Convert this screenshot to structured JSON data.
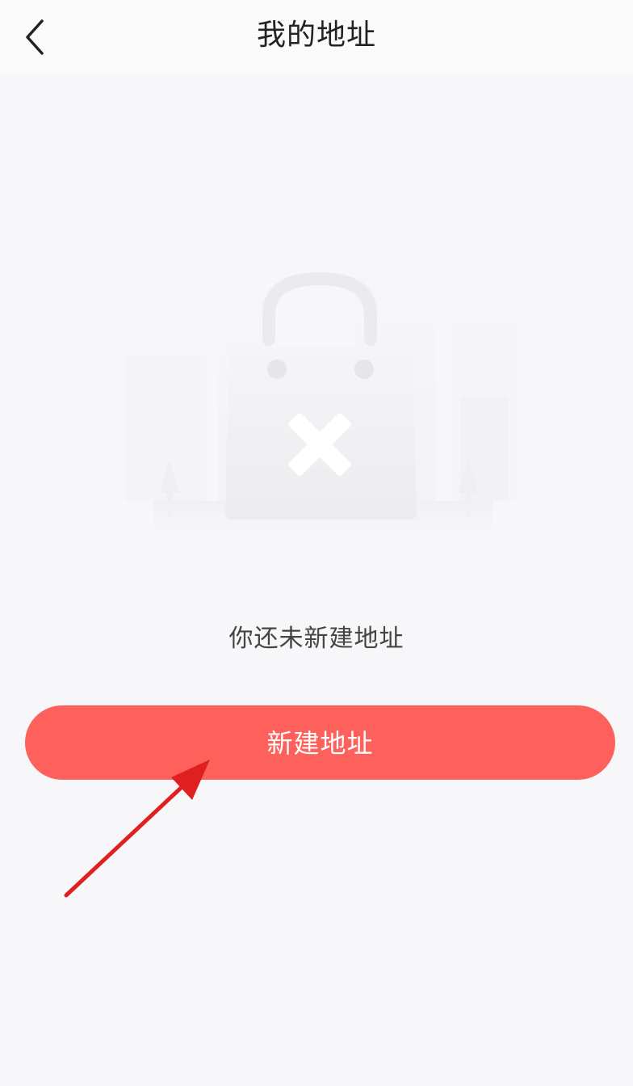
{
  "header": {
    "back_icon": "chevron-left-icon",
    "title": "我的地址"
  },
  "empty_state": {
    "illustration_icon": "empty-shopping-bag-icon",
    "message": "你还未新建地址"
  },
  "actions": {
    "new_address_label": "新建地址"
  },
  "colors": {
    "accent": "#fe615c",
    "background": "#f7f7f9",
    "annotation_arrow": "#e02020"
  }
}
